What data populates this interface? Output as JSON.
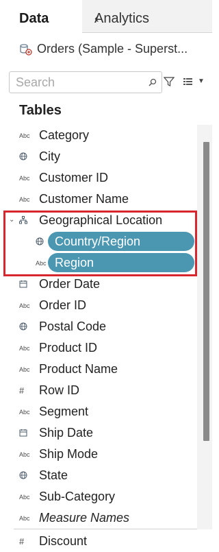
{
  "tabs": {
    "data": "Data",
    "analytics": "Analytics",
    "collapse": "‹"
  },
  "datasource": {
    "label": "Orders (Sample - Superst...",
    "icon": "datasource-icon"
  },
  "search": {
    "placeholder": "Search"
  },
  "tables_header": "Tables",
  "fields": [
    {
      "type": "abc",
      "icon_text": "Abc",
      "label": "Category"
    },
    {
      "type": "geo",
      "label": "City"
    },
    {
      "type": "abc",
      "icon_text": "Abc",
      "label": "Customer ID"
    },
    {
      "type": "abc",
      "icon_text": "Abc",
      "label": "Customer Name"
    },
    {
      "type": "hierarchy",
      "label": "Geographical Location"
    },
    {
      "type": "geo",
      "label": "Country/Region",
      "selected": true
    },
    {
      "type": "abc",
      "icon_text": "Abc",
      "label": "Region",
      "selected": true
    },
    {
      "type": "date",
      "label": "Order Date"
    },
    {
      "type": "abc",
      "icon_text": "Abc",
      "label": "Order ID"
    },
    {
      "type": "geo",
      "label": "Postal Code"
    },
    {
      "type": "abc",
      "icon_text": "Abc",
      "label": "Product ID"
    },
    {
      "type": "abc",
      "icon_text": "Abc",
      "label": "Product Name"
    },
    {
      "type": "number",
      "icon_text": "#",
      "label": "Row ID"
    },
    {
      "type": "abc",
      "icon_text": "Abc",
      "label": "Segment"
    },
    {
      "type": "date",
      "label": "Ship Date"
    },
    {
      "type": "abc",
      "icon_text": "Abc",
      "label": "Ship Mode"
    },
    {
      "type": "geo",
      "label": "State"
    },
    {
      "type": "abc",
      "icon_text": "Abc",
      "label": "Sub-Category"
    },
    {
      "type": "abc",
      "icon_text": "Abc",
      "label": "Measure Names"
    },
    {
      "type": "number",
      "icon_text": "#",
      "label": "Discount"
    }
  ],
  "colors": {
    "pill": "#4b96b1",
    "highlight_frame": "#d8262e"
  }
}
